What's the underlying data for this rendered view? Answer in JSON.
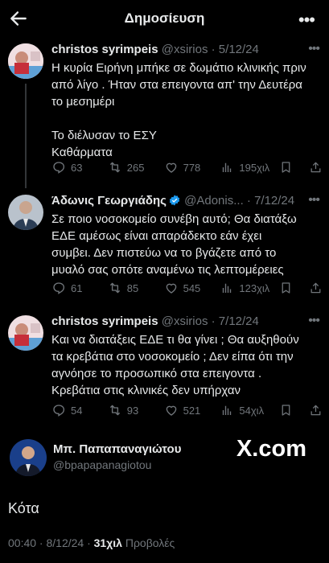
{
  "header": {
    "title": "Δημοσίευση"
  },
  "tweets": [
    {
      "name": "christos syrimpeis",
      "handle": "@xsirios",
      "date": "· 5/12/24",
      "text_lines": [
        "Η κυρία Ειρήνη μπήκε σε δωμάτιο κλινικής πριν",
        "από λίγο . Ήταν στα επειγοντα απ' την Δευτέρα",
        "το μεσημέρι",
        "",
        "Το διέλυσαν το ΕΣΥ",
        "Καθάρματα"
      ],
      "replies": "63",
      "reposts": "265",
      "likes": "778",
      "views": "195χιλ"
    },
    {
      "name": "Άδωνις Γεωργιάδης",
      "handle": "@Adonis...",
      "date": "· 7/12/24",
      "verified": true,
      "text_lines": [
        "Σε ποιο νοσοκομείο συνέβη αυτό; Θα διατάξω",
        "ΕΔΕ αμέσως είναι απαράδεκτο εάν έχει",
        "συμβει. Δεν πιστεύω να το βγάζετε από το",
        "μυαλό σας οπότε αναμένω τις λεπτομέρειες"
      ],
      "replies": "61",
      "reposts": "85",
      "likes": "545",
      "views": "123χιλ"
    },
    {
      "name": "christos syrimpeis",
      "handle": "@xsirios",
      "date": "· 7/12/24",
      "text_lines": [
        "Και να διατάξεις ΕΔΕ τι θα γίνει ; Θα αυξηθούν",
        "τα κρεβάτια στο νοσοκομείο ; Δεν είπα ότι την",
        "αγνόησε το προσωπικό στα επειγοντα .",
        "Κρεβάτια στις κλινικές δεν υπήρχαν"
      ],
      "replies": "54",
      "reposts": "93",
      "likes": "521",
      "views": "54χιλ"
    }
  ],
  "main_post": {
    "name": "Μπ. Παπαπαναγιώτου",
    "handle": "@bpapapanagiotou",
    "watermark": "X.com",
    "text": "Κότα",
    "time": "00:40 · 8/12/24 · ",
    "views_count": "31χιλ",
    "views_label": " Προβολές"
  },
  "colors": {
    "background": "#000000",
    "text": "#e7e9ea",
    "muted": "#71767b",
    "verified": "#1d9bf0"
  }
}
